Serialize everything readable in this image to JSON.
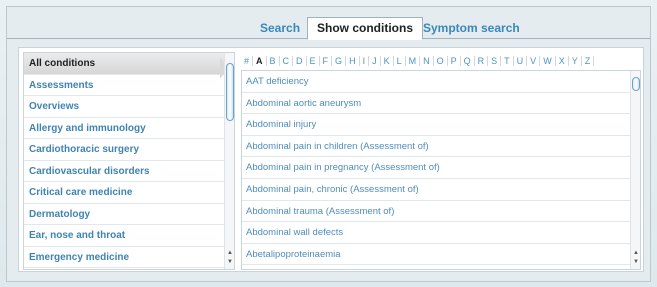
{
  "tabs": {
    "search": "Search",
    "show_conditions": "Show conditions",
    "symptom_search": "Symptom search"
  },
  "categories": [
    "All conditions",
    "Assessments",
    "Overviews",
    "Allergy and immunology",
    "Cardiothoracic surgery",
    "Cardiovascular disorders",
    "Critical care medicine",
    "Dermatology",
    "Ear, nose and throat",
    "Emergency medicine"
  ],
  "selected_category": "All conditions",
  "alphabet": [
    "#",
    "A",
    "B",
    "C",
    "D",
    "E",
    "F",
    "G",
    "H",
    "I",
    "J",
    "K",
    "L",
    "M",
    "N",
    "O",
    "P",
    "Q",
    "R",
    "S",
    "T",
    "U",
    "V",
    "W",
    "X",
    "Y",
    "Z"
  ],
  "selected_letter": "A",
  "conditions": [
    "AAT deficiency",
    "Abdominal aortic aneurysm",
    "Abdominal injury",
    "Abdominal pain in children (Assessment of)",
    "Abdominal pain in pregnancy (Assessment of)",
    "Abdominal pain, chronic (Assessment of)",
    "Abdominal trauma (Assessment of)",
    "Abdominal wall defects",
    "Abetalipoproteinaemia"
  ],
  "icons": {
    "scroll_up": "arrow-up-icon",
    "scroll_down": "arrow-down-icon"
  },
  "colors": {
    "link": "#3f83b1",
    "selected_bg": "#dcdcdc",
    "border": "#9fb3bd"
  }
}
